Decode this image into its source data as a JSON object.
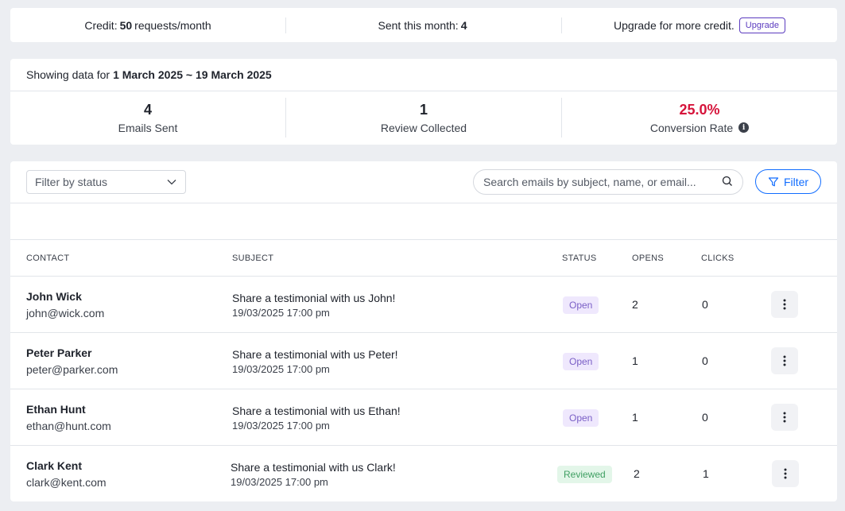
{
  "credit": {
    "credit_prefix": "Credit:",
    "credit_value": "50",
    "credit_suffix": "requests/month",
    "sent_prefix": "Sent this month:",
    "sent_value": "4",
    "upgrade_text": "Upgrade for more credit.",
    "upgrade_label": "Upgrade"
  },
  "range": {
    "prefix": "Showing data for",
    "value": "1 March 2025 ~ 19 March 2025"
  },
  "stats": [
    {
      "value": "4",
      "label": "Emails Sent"
    },
    {
      "value": "1",
      "label": "Review Collected"
    },
    {
      "value": "25.0%",
      "label": "Conversion Rate",
      "color": "#d6143b"
    }
  ],
  "toolbar": {
    "status_placeholder": "Filter by status",
    "search_placeholder": "Search emails by subject, name, or email...",
    "filter_label": "Filter"
  },
  "table": {
    "headers": {
      "contact": "CONTACT",
      "subject": "SUBJECT",
      "status": "STATUS",
      "opens": "OPENS",
      "clicks": "CLICKS"
    },
    "rows": [
      {
        "name": "John Wick",
        "email": "john@wick.com",
        "subject": "Share a testimonial with us John!",
        "date": "19/03/2025 17:00 pm",
        "status": "Open",
        "opens": "2",
        "clicks": "0"
      },
      {
        "name": "Peter Parker",
        "email": "peter@parker.com",
        "subject": "Share a testimonial with us Peter!",
        "date": "19/03/2025 17:00 pm",
        "status": "Open",
        "opens": "1",
        "clicks": "0"
      },
      {
        "name": "Ethan Hunt",
        "email": "ethan@hunt.com",
        "subject": "Share a testimonial with us Ethan!",
        "date": "19/03/2025 17:00 pm",
        "status": "Open",
        "opens": "1",
        "clicks": "0"
      },
      {
        "name": "Clark Kent",
        "email": "clark@kent.com",
        "subject": "Share a testimonial with us Clark!",
        "date": "19/03/2025 17:00 pm",
        "status": "Reviewed",
        "opens": "2",
        "clicks": "1"
      }
    ]
  },
  "colors": {
    "accent": "#116dff",
    "upgrade": "#5b3bbf",
    "conversion": "#d6143b",
    "open_badge": "#efe8fd",
    "reviewed_badge": "#e3f6e9"
  }
}
